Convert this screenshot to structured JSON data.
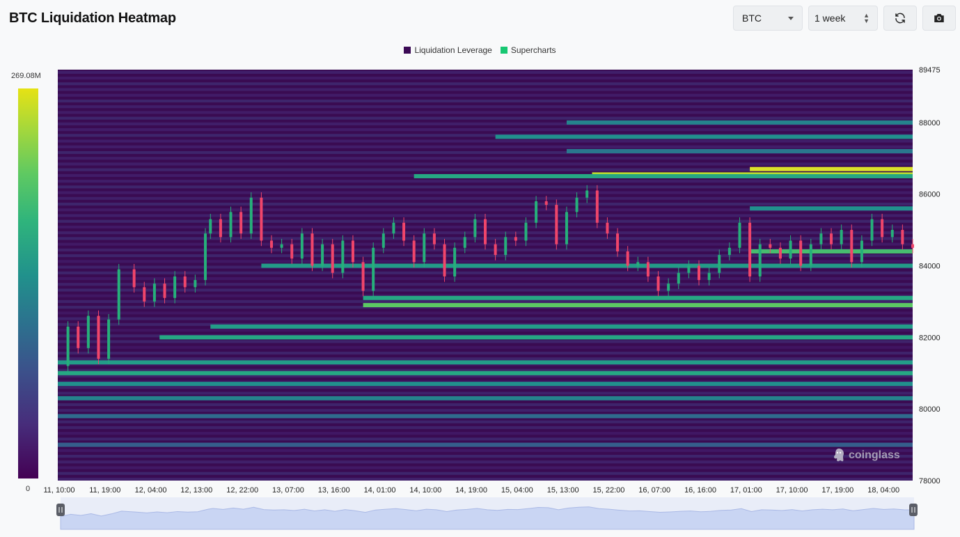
{
  "header": {
    "title": "BTC Liquidation Heatmap",
    "coin_select": {
      "value": "BTC"
    },
    "range_select": {
      "value": "1 week"
    },
    "refresh_icon": "refresh-icon",
    "camera_icon": "camera-icon"
  },
  "legend": [
    {
      "label": "Liquidation Leverage",
      "color": "#3b0a55"
    },
    {
      "label": "Supercharts",
      "color": "#17c772"
    }
  ],
  "colorbar": {
    "max_label": "269.08M",
    "min_label": "0"
  },
  "watermark": {
    "text": "coinglass"
  },
  "chart_data": {
    "type": "heatmap",
    "title": "BTC Liquidation Heatmap",
    "y_ticks": [
      "89475",
      "88000",
      "86000",
      "84000",
      "82000",
      "80000",
      "78000"
    ],
    "ylim": [
      78000,
      89475
    ],
    "x_ticks": [
      "11, 10:00",
      "11, 19:00",
      "12, 04:00",
      "12, 13:00",
      "12, 22:00",
      "13, 07:00",
      "13, 16:00",
      "14, 01:00",
      "14, 10:00",
      "14, 19:00",
      "15, 04:00",
      "15, 13:00",
      "15, 22:00",
      "16, 07:00",
      "16, 16:00",
      "17, 01:00",
      "17, 10:00",
      "17, 19:00",
      "18, 04:00"
    ],
    "colorscale": {
      "min": 0,
      "max": 269080000,
      "unit": "USD",
      "palette": "viridis"
    },
    "price_series": {
      "name": "Supercharts",
      "x_hours": [
        0,
        2,
        4,
        6,
        8,
        10,
        12,
        15,
        17,
        19,
        21,
        23,
        25,
        27,
        29,
        30,
        32,
        34,
        36,
        38,
        40,
        42,
        44,
        46,
        48,
        50,
        52,
        54,
        56,
        58,
        60,
        62,
        64,
        66,
        68,
        70,
        72,
        74,
        76,
        78,
        80,
        82,
        84,
        86,
        88,
        90,
        92,
        94,
        96,
        98,
        100,
        102,
        104,
        106,
        108,
        110,
        112,
        114,
        116,
        118,
        120,
        122,
        124,
        126,
        128,
        130,
        132,
        134,
        136,
        138,
        140,
        142,
        144,
        146,
        148,
        150,
        152,
        154,
        156,
        158,
        160,
        162,
        164,
        166,
        168
      ],
      "close": [
        81200,
        82300,
        81700,
        82600,
        81400,
        82500,
        83900,
        83400,
        83000,
        83500,
        83100,
        83700,
        83400,
        83600,
        84900,
        85300,
        84800,
        85500,
        84900,
        85900,
        84700,
        84500,
        84600,
        84200,
        84900,
        84000,
        84600,
        83800,
        84700,
        84100,
        83300,
        84500,
        84900,
        85200,
        84700,
        84100,
        84900,
        84600,
        83700,
        84500,
        84800,
        85300,
        84600,
        84300,
        84800,
        84700,
        85200,
        85800,
        85700,
        84600,
        85500,
        85900,
        86100,
        85200,
        84900,
        84400,
        84000,
        84100,
        83700,
        83300,
        83500,
        83800,
        84000,
        83600,
        83800,
        84300,
        84500,
        85200,
        83700,
        84600,
        84500,
        84200,
        84700,
        84000,
        84600,
        84900,
        84600,
        85000,
        84100,
        84700,
        85300,
        84800,
        85000,
        84600,
        84500
      ]
    },
    "bands": [
      {
        "price": 86700,
        "start_hour": 136,
        "level": 0.95
      },
      {
        "price": 86550,
        "start_hour": 105,
        "level": 0.9
      },
      {
        "price": 86500,
        "start_hour": 70,
        "level": 0.6
      },
      {
        "price": 85600,
        "start_hour": 136,
        "level": 0.5
      },
      {
        "price": 84400,
        "start_hour": 136,
        "level": 0.7
      },
      {
        "price": 84000,
        "start_hour": 40,
        "level": 0.55
      },
      {
        "price": 83100,
        "start_hour": 60,
        "level": 0.6
      },
      {
        "price": 82900,
        "start_hour": 60,
        "level": 0.75
      },
      {
        "price": 82300,
        "start_hour": 30,
        "level": 0.55
      },
      {
        "price": 82000,
        "start_hour": 20,
        "level": 0.6
      },
      {
        "price": 81300,
        "start_hour": 0,
        "level": 0.55
      },
      {
        "price": 81000,
        "start_hour": 0,
        "level": 0.6
      },
      {
        "price": 80700,
        "start_hour": 0,
        "level": 0.5
      },
      {
        "price": 80300,
        "start_hour": 0,
        "level": 0.45
      },
      {
        "price": 79800,
        "start_hour": 0,
        "level": 0.35
      },
      {
        "price": 79000,
        "start_hour": 0,
        "level": 0.3
      },
      {
        "price": 88000,
        "start_hour": 100,
        "level": 0.45
      },
      {
        "price": 87600,
        "start_hour": 86,
        "level": 0.5
      },
      {
        "price": 87200,
        "start_hour": 100,
        "level": 0.4
      }
    ]
  }
}
